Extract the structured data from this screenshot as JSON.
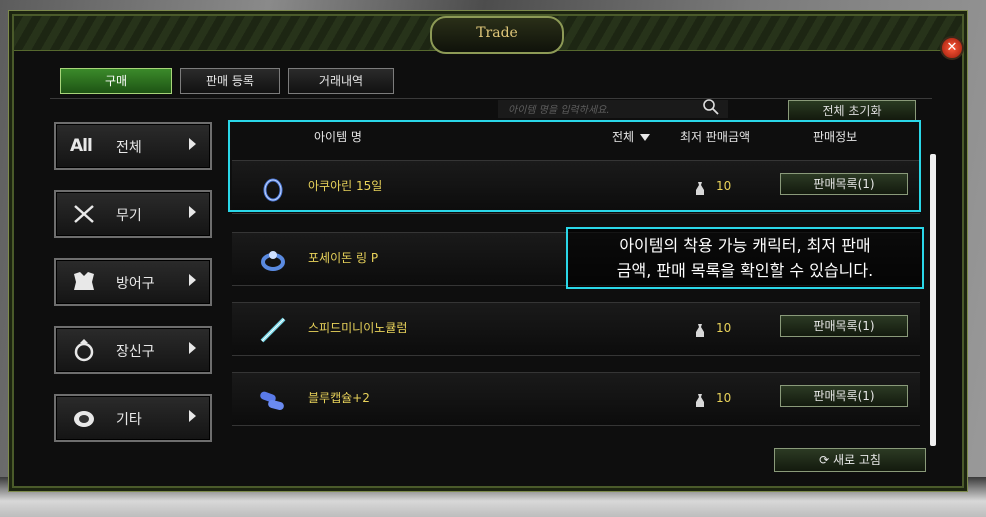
{
  "window": {
    "title": "Trade",
    "close_symbol": "✕"
  },
  "tabs": [
    {
      "label": "구매",
      "active": true
    },
    {
      "label": "판매 등록",
      "active": false
    },
    {
      "label": "거래내역",
      "active": false
    }
  ],
  "search": {
    "placeholder": "아이템 명을 입력하세요."
  },
  "reset_label": "전체 초기화",
  "categories": [
    {
      "label": "전체",
      "icon_text": "All",
      "icon": "all-icon"
    },
    {
      "label": "무기",
      "icon": "weapon-icon"
    },
    {
      "label": "방어구",
      "icon": "armor-icon"
    },
    {
      "label": "장신구",
      "icon": "ring-icon"
    },
    {
      "label": "기타",
      "icon": "misc-icon"
    }
  ],
  "list_header": {
    "name": "아이템 명",
    "filter": "전체",
    "price": "최저 판매금액",
    "info": "판매정보"
  },
  "items": [
    {
      "name": "아쿠아린 15일",
      "price": "10",
      "sell_label": "판매목록(1)",
      "icon": "ring-item-icon"
    },
    {
      "name": "포세이돈 링 P",
      "price": "",
      "sell_label": "",
      "icon": "poseidon-ring-icon"
    },
    {
      "name": "스피드미니이노큘럼",
      "price": "10",
      "sell_label": "판매목록(1)",
      "icon": "syringe-icon"
    },
    {
      "name": "블루캡슐+2",
      "price": "10",
      "sell_label": "판매목록(1)",
      "icon": "capsule-icon"
    }
  ],
  "refresh_label": "새로 고침",
  "tooltip": {
    "line1": "아이템의 착용 가능 캐릭터, 최저 판매",
    "line2": "금액, 판매 목록을 확인할 수 있습니다."
  },
  "colors": {
    "accent": "#2ad7e8",
    "item_name": "#e8d25a",
    "active_tab": "#3b8a2a"
  }
}
